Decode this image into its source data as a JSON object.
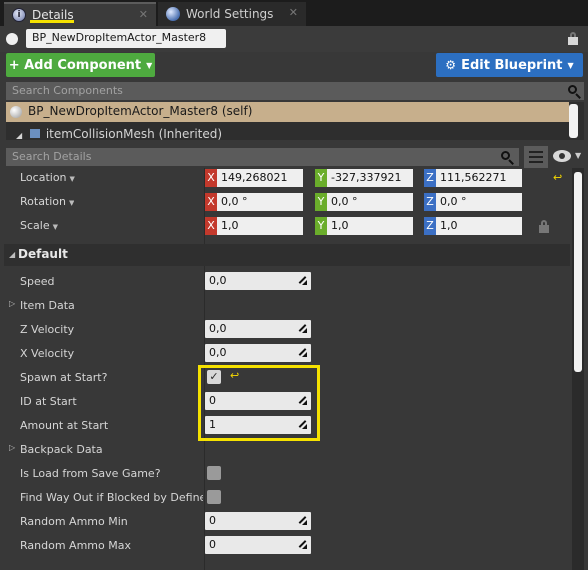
{
  "tabs": {
    "details": "Details",
    "world_settings": "World Settings",
    "close": "✕"
  },
  "actor": {
    "name": "BP_NewDropItemActor_Master8"
  },
  "toolbar": {
    "add_component": "+ Add Component",
    "edit_blueprint": "Edit Blueprint"
  },
  "components": {
    "search_placeholder": "Search Components",
    "self_item": "BP_NewDropItemActor_Master8 (self)",
    "child_item": "itemCollisionMesh (Inherited)"
  },
  "details": {
    "search_placeholder": "Search Details",
    "transform": {
      "location": {
        "label": "Location",
        "x": "149,268021",
        "y": "-327,337921",
        "z": "111,562271"
      },
      "rotation": {
        "label": "Rotation",
        "x": "0,0 °",
        "y": "0,0 °",
        "z": "0,0 °"
      },
      "scale": {
        "label": "Scale",
        "x": "1,0",
        "y": "1,0",
        "z": "1,0"
      }
    },
    "axis": {
      "x": "X",
      "y": "Y",
      "z": "Z"
    },
    "section_default": "Default",
    "props": {
      "speed": {
        "label": "Speed",
        "value": "0,0"
      },
      "item_data": {
        "label": "Item Data"
      },
      "z_velocity": {
        "label": "Z Velocity",
        "value": "0,0"
      },
      "x_velocity": {
        "label": "X Velocity",
        "value": "0,0"
      },
      "spawn_at_start": {
        "label": "Spawn at Start?",
        "checked": true
      },
      "id_at_start": {
        "label": "ID at Start",
        "value": "0"
      },
      "amount_at_start": {
        "label": "Amount at Start",
        "value": "1"
      },
      "backpack_data": {
        "label": "Backpack Data"
      },
      "is_load_from_save": {
        "label": "Is Load from Save Game?",
        "checked": false
      },
      "find_way_out": {
        "label": "Find Way Out if Blocked by Defined C",
        "checked": false
      },
      "random_ammo_min": {
        "label": "Random Ammo Min",
        "value": "0"
      },
      "random_ammo_max": {
        "label": "Random Ammo Max",
        "value": "0"
      }
    }
  },
  "colors": {
    "add_button": "#4eaa3f",
    "edit_button": "#2c6fc1",
    "highlight": "#f5e100",
    "selected_component": "#c7af8c"
  }
}
